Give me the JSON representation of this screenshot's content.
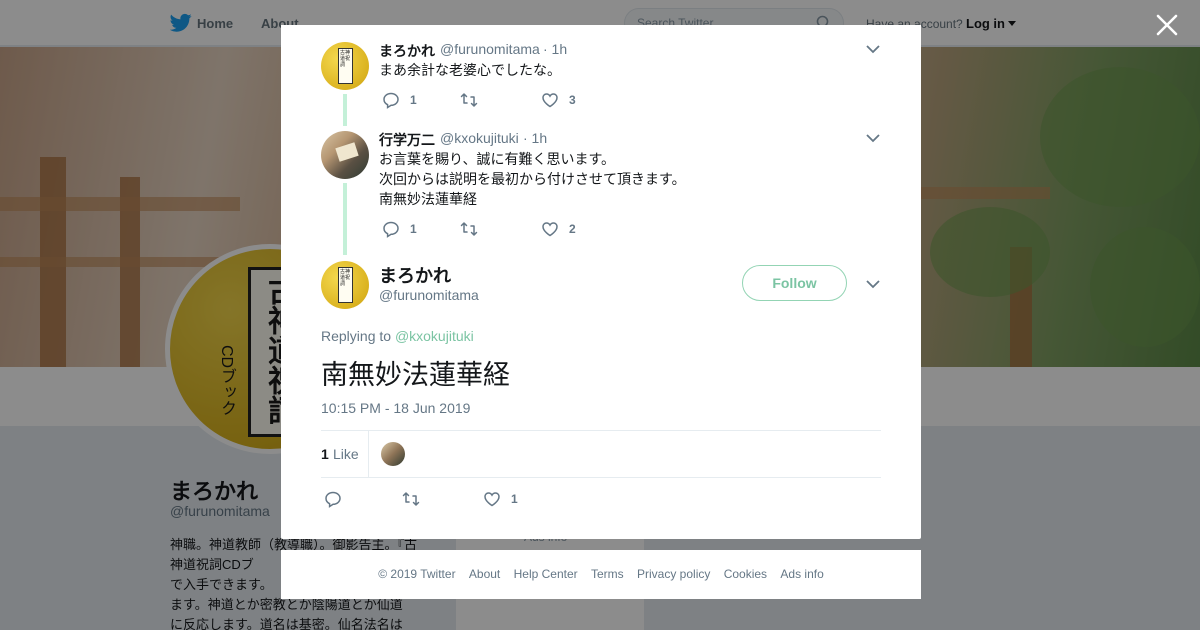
{
  "topbar": {
    "home_label": "Home",
    "about_label": "About",
    "search_placeholder": "Search Twitter",
    "have_account": "Have an account?",
    "login_label": "Log in"
  },
  "profile": {
    "name": "まろかれ",
    "handle": "@furunomitama",
    "avatar_cover_title": "古神道祝詞",
    "avatar_cover_sub": "CDブック",
    "bio": "神職。神道教師（教導職）。御影告主。『古神道祝詞CDブ\nで入手できます。\nます。神道とか密教とか陰陽道とか仙道\nに反応します。道名は基密。仙名法名は",
    "ads_info": "Ads info"
  },
  "thread": [
    {
      "name": "まろかれ",
      "handle": "@furunomitama",
      "time": "· 1h",
      "text": "まあ余計な老婆心でしたな。",
      "replies": "1",
      "retweets": "",
      "likes": "3"
    },
    {
      "name": "行学万二",
      "handle": "@kxokujituki",
      "time": "· 1h",
      "text": "お言葉を賜り、誠に有難く思います。\n次回からは説明を最初から付けさせて頂きます。\n南無妙法蓮華経",
      "replies": "1",
      "retweets": "",
      "likes": "2"
    }
  ],
  "main_tweet": {
    "name": "まろかれ",
    "handle": "@furunomitama",
    "follow_label": "Follow",
    "replying_prefix": "Replying to",
    "replying_to": "@kxokujituki",
    "text": "南無妙法蓮華経",
    "timestamp": "10:15 PM - 18 Jun 2019",
    "like_count": "1",
    "like_label": "Like",
    "action_replies": "",
    "action_retweets": "",
    "action_likes": "1"
  },
  "footer": {
    "copyright": "© 2019 Twitter",
    "links": [
      "About",
      "Help Center",
      "Terms",
      "Privacy policy",
      "Cookies",
      "Ads info"
    ]
  },
  "colors": {
    "accent": "#7bc4a3",
    "thread_line": "#c4f0d8",
    "overlay": "rgba(0,0,0,0.45)",
    "muted": "#657786"
  }
}
